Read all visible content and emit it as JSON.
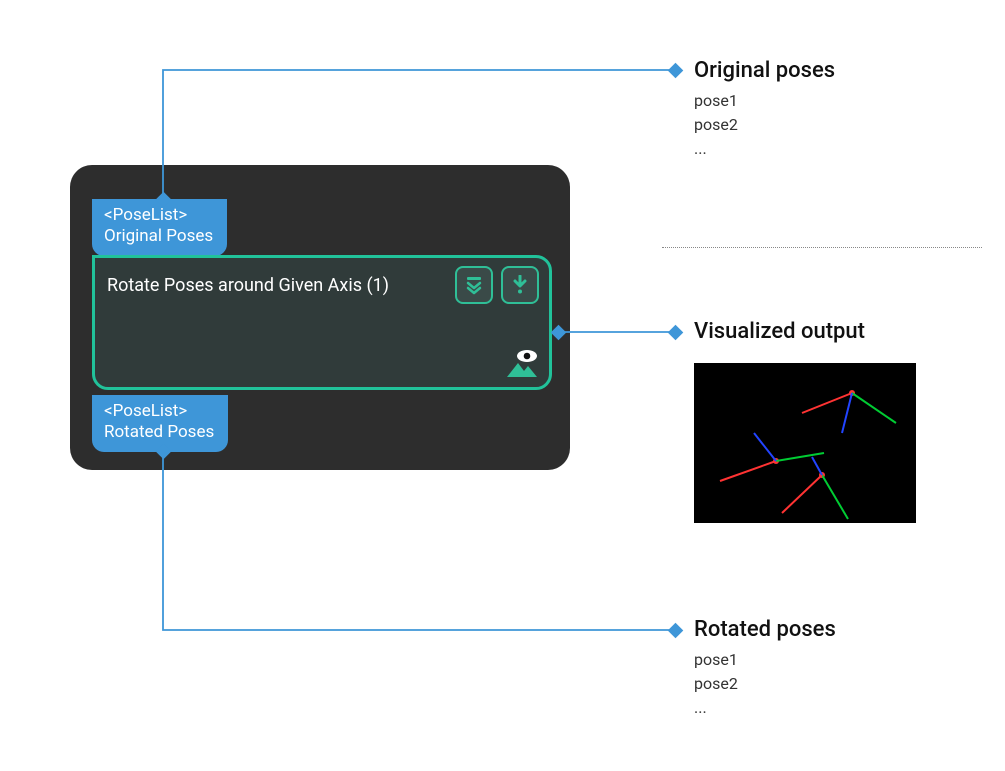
{
  "colors": {
    "tag_blue": "#3e96d8",
    "node_border": "#21c29a",
    "panel_bg": "#2d2d2d"
  },
  "input_tag": {
    "type": "<PoseList>",
    "label": "Original Poses"
  },
  "output_tag": {
    "type": "<PoseList>",
    "label": "Rotated Poses"
  },
  "node": {
    "title": "Rotate Poses around Given Axis (1)"
  },
  "annotations": {
    "original": {
      "title": "Original poses",
      "items": [
        "pose1",
        "pose2",
        "..."
      ]
    },
    "visualized": {
      "title": "Visualized output"
    },
    "rotated": {
      "title": "Rotated poses",
      "items": [
        "pose1",
        "pose2",
        "..."
      ]
    }
  }
}
